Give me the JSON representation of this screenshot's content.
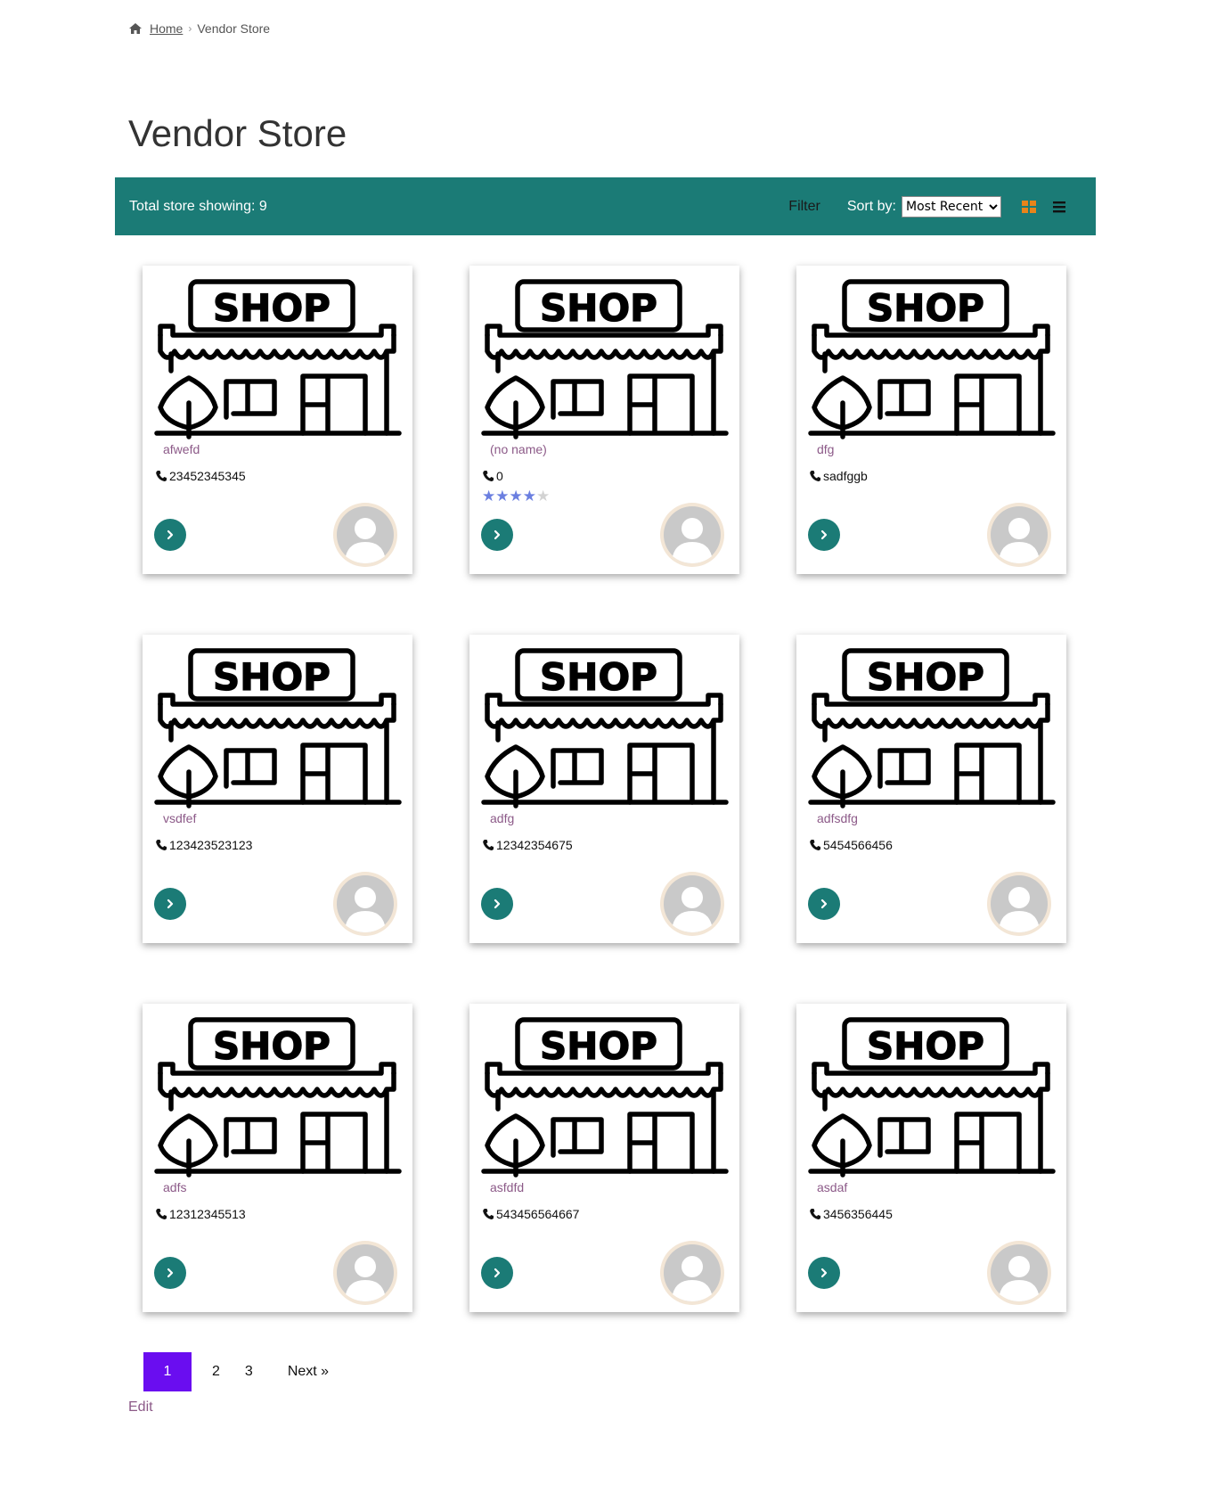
{
  "breadcrumb": {
    "home": "Home",
    "current": "Vendor Store"
  },
  "page": {
    "title": "Vendor Store"
  },
  "toolbar": {
    "count_text": "Total store showing: 9",
    "filter_label": "Filter",
    "sort_label": "Sort by:",
    "sort_selected": "Most Recent",
    "grid_view_icon": "grid-icon",
    "list_view_icon": "list-icon"
  },
  "stores": [
    {
      "name": "afwefd",
      "phone": "23452345345",
      "rating": null
    },
    {
      "name": "(no name)",
      "phone": "0",
      "rating": 4
    },
    {
      "name": "dfg",
      "phone": "sadfggb",
      "rating": null
    },
    {
      "name": "vsdfef",
      "phone": "123423523123",
      "rating": null
    },
    {
      "name": "adfg",
      "phone": "12342354675",
      "rating": null
    },
    {
      "name": "adfsdfg",
      "phone": "5454566456",
      "rating": null
    },
    {
      "name": "adfs",
      "phone": "12312345513",
      "rating": null
    },
    {
      "name": "asfdfd",
      "phone": "543456564667",
      "rating": null
    },
    {
      "name": "asdaf",
      "phone": "3456356445",
      "rating": null
    }
  ],
  "pagination": {
    "current": "1",
    "pages": [
      "2",
      "3"
    ],
    "next": "Next »"
  },
  "edit_link": "Edit",
  "colors": {
    "accent": "#1b7b76",
    "page_active": "#6a0df0",
    "link": "#8c5a88",
    "star": "#6b7fe0"
  }
}
